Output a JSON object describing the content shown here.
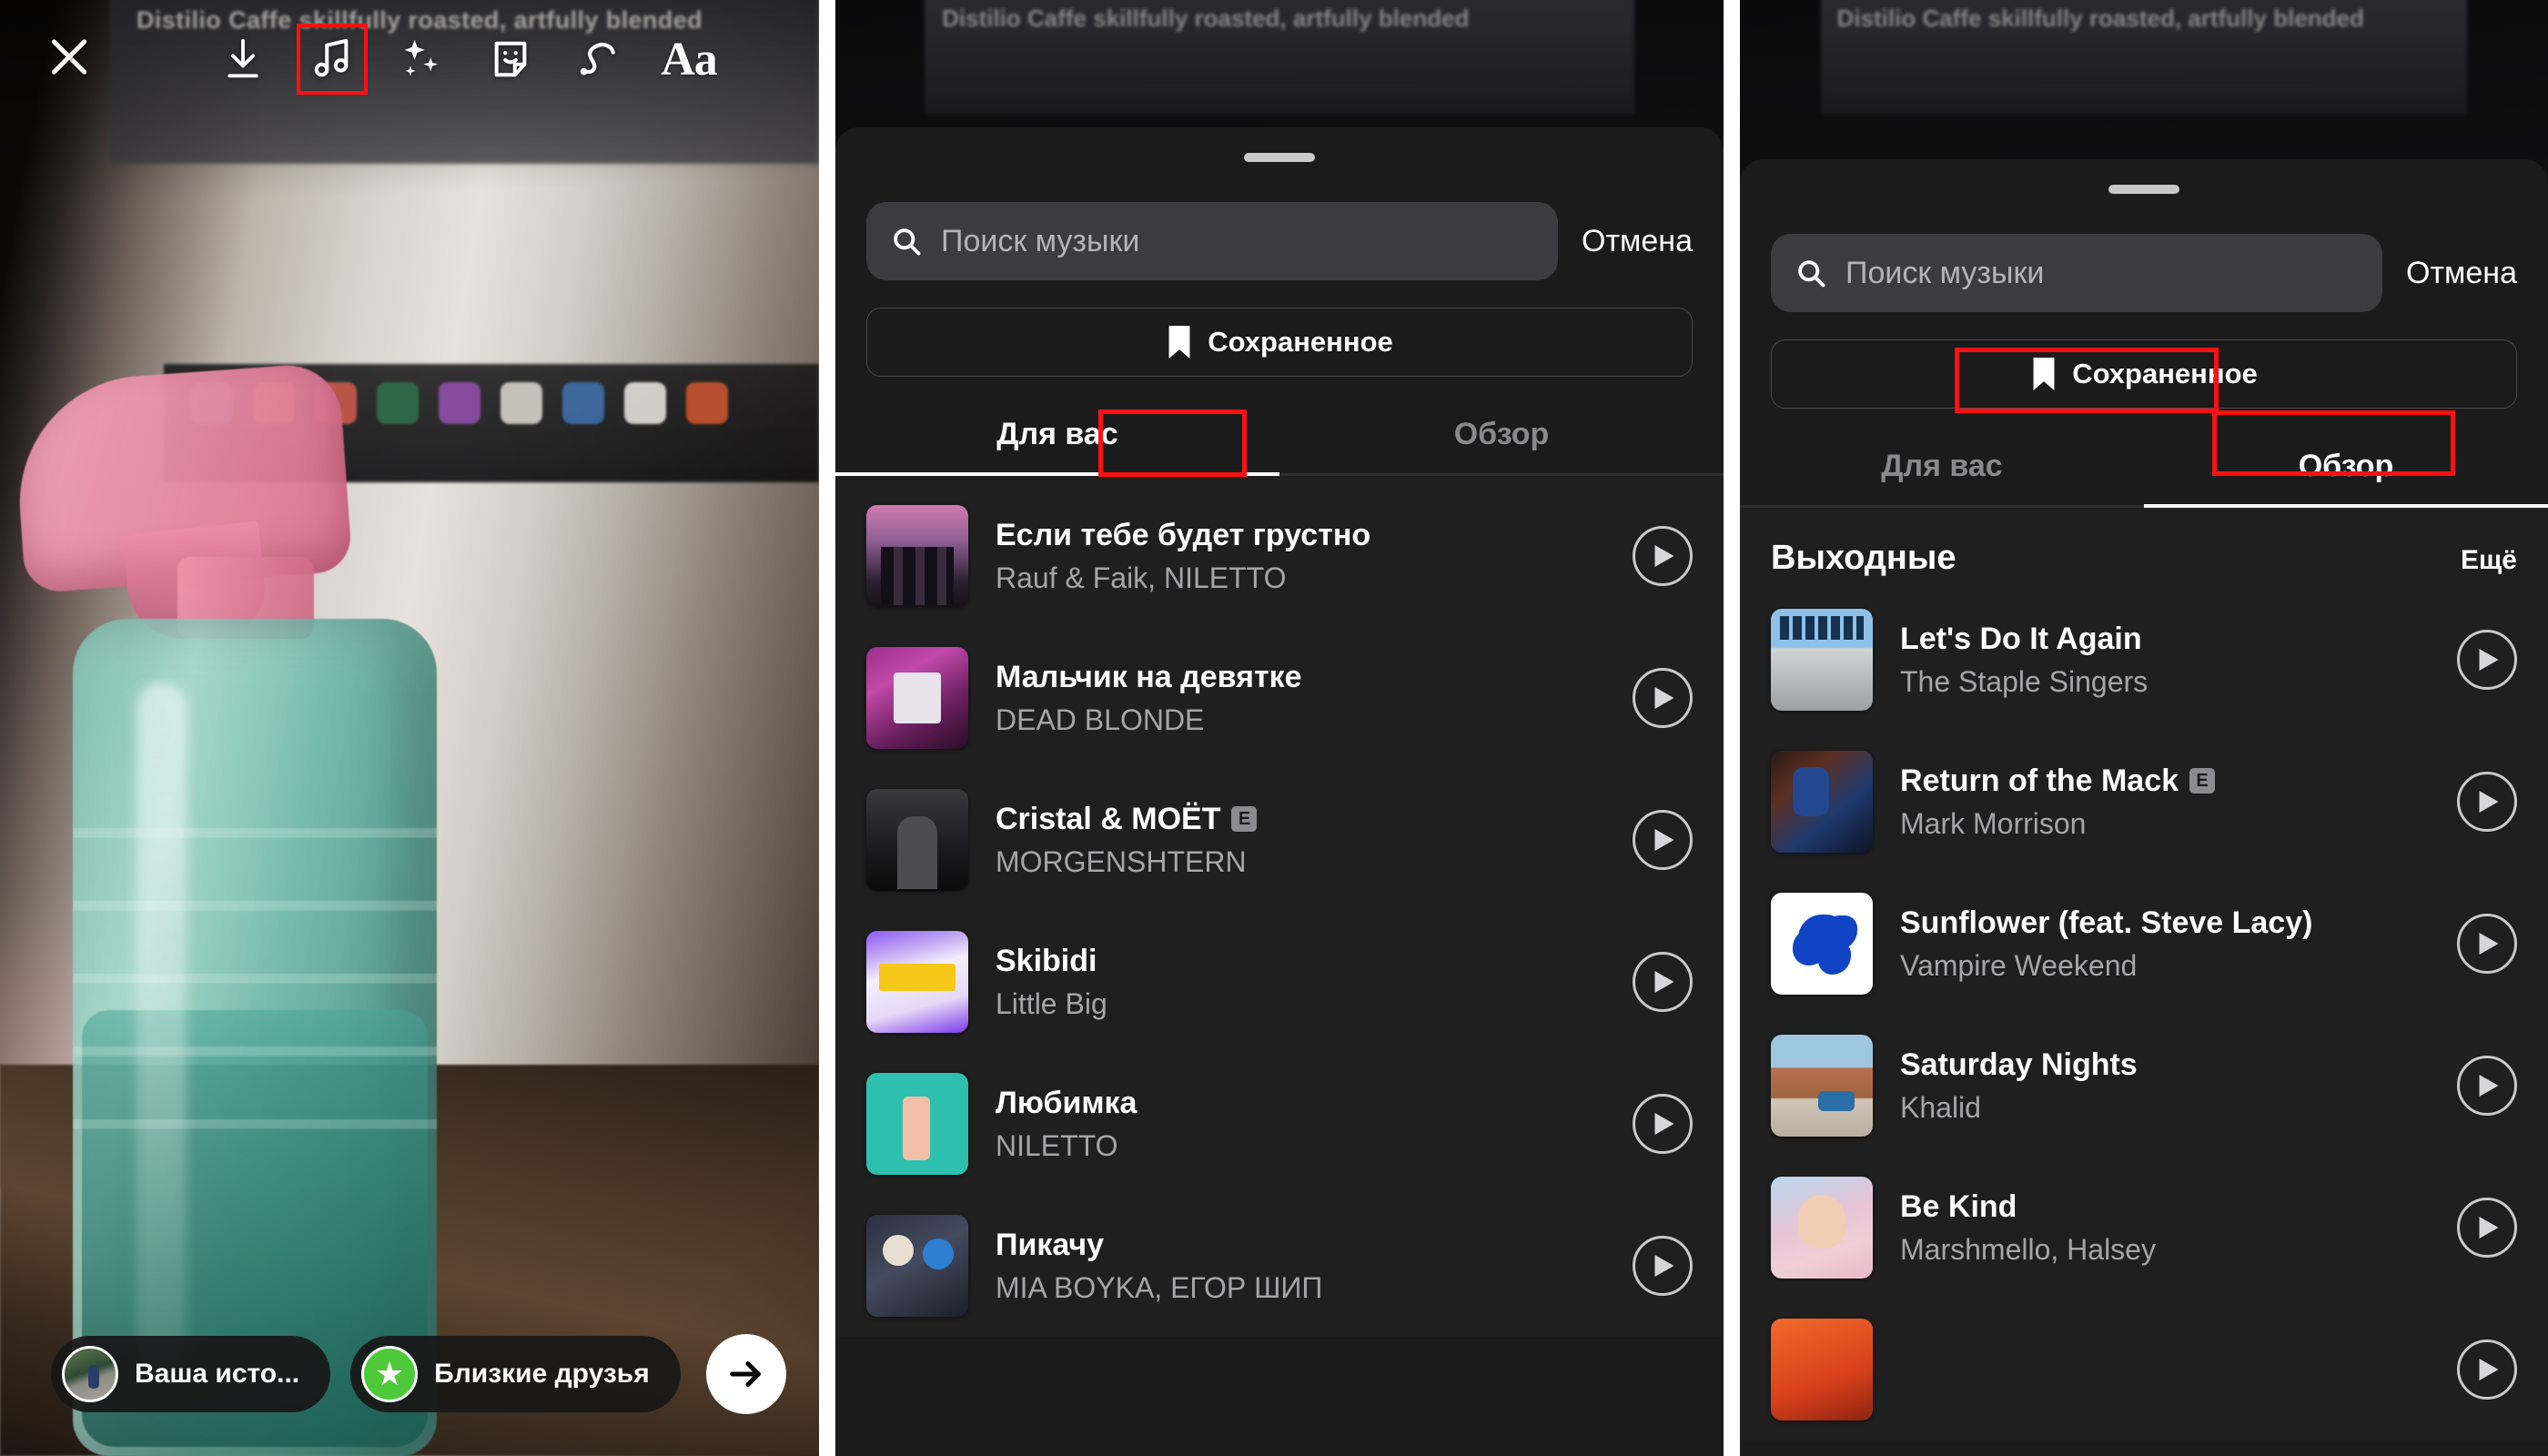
{
  "panel1": {
    "photo_overlay_text": "Distilio Caffe skillfully roasted, artfully blended",
    "close_label": "Закрыть",
    "tools": [
      {
        "name": "download-icon",
        "label": "Скачать",
        "highlighted": false
      },
      {
        "name": "music-icon",
        "label": "Музыка",
        "highlighted": true
      },
      {
        "name": "effects-sparkle-icon",
        "label": "Эффекты",
        "highlighted": false
      },
      {
        "name": "sticker-icon",
        "label": "Стикер",
        "highlighted": false
      },
      {
        "name": "draw-icon",
        "label": "Рисование",
        "highlighted": false
      },
      {
        "name": "text-aa-icon",
        "label": "Aa",
        "highlighted": false
      }
    ],
    "bottom": {
      "your_story": "Ваша исто...",
      "close_friends": "Близкие друзья",
      "next_label": "Далее"
    }
  },
  "panel2": {
    "search": {
      "placeholder": "Поиск музыки",
      "value": "",
      "cancel": "Отмена"
    },
    "saved_button": "Сохраненное",
    "tabs": [
      {
        "label": "Для вас",
        "active": true,
        "highlighted": true
      },
      {
        "label": "Обзор",
        "active": false,
        "highlighted": false
      }
    ],
    "tracks": [
      {
        "title": "Если тебе будет грустно",
        "artist": "Rauf & Faik, NILETTO",
        "explicit": false,
        "cover": "cv-rauf"
      },
      {
        "title": "Мальчик на девятке",
        "artist": "DEAD BLONDE",
        "explicit": false,
        "cover": "cv-dead"
      },
      {
        "title": "Cristal & MOËT",
        "artist": "MORGENSHTERN",
        "explicit": true,
        "cover": "cv-morgen"
      },
      {
        "title": "Skibidi",
        "artist": "Little Big",
        "explicit": false,
        "cover": "cv-skibidi"
      },
      {
        "title": "Любимка",
        "artist": "NILETTO",
        "explicit": false,
        "cover": "cv-lubimka"
      },
      {
        "title": "Пикачу",
        "artist": "MIA BOYKA, ЕГОР ШИП",
        "explicit": false,
        "cover": "cv-pikachu"
      }
    ]
  },
  "panel3": {
    "search": {
      "placeholder": "Поиск музыки",
      "value": "",
      "cancel": "Отмена"
    },
    "saved_button": "Сохраненное",
    "tabs": [
      {
        "label": "Для вас",
        "active": false,
        "highlighted": false
      },
      {
        "label": "Обзор",
        "active": true,
        "highlighted": true
      }
    ],
    "section": {
      "title": "Выходные",
      "more": "Ещё"
    },
    "tracks": [
      {
        "title": "Let's Do It Again",
        "artist": "The Staple Singers",
        "explicit": false,
        "cover": "cv-staple"
      },
      {
        "title": "Return of the Mack",
        "artist": "Mark Morrison",
        "explicit": true,
        "cover": "cv-mack"
      },
      {
        "title": "Sunflower (feat. Steve Lacy)",
        "artist": "Vampire Weekend",
        "explicit": false,
        "cover": "cv-sunflower"
      },
      {
        "title": "Saturday Nights",
        "artist": "Khalid",
        "explicit": false,
        "cover": "cv-saturday"
      },
      {
        "title": "Be Kind",
        "artist": "Marshmello, Halsey",
        "explicit": false,
        "cover": "cv-bekind"
      }
    ]
  },
  "colors": {
    "highlight": "#ff1111",
    "sheet_bg": "#1b1b1b",
    "list_bg": "#1f1f1f",
    "accent_green": "#4ec93a",
    "secondary_text": "#a6a6a9"
  },
  "explicit_badge": "E"
}
